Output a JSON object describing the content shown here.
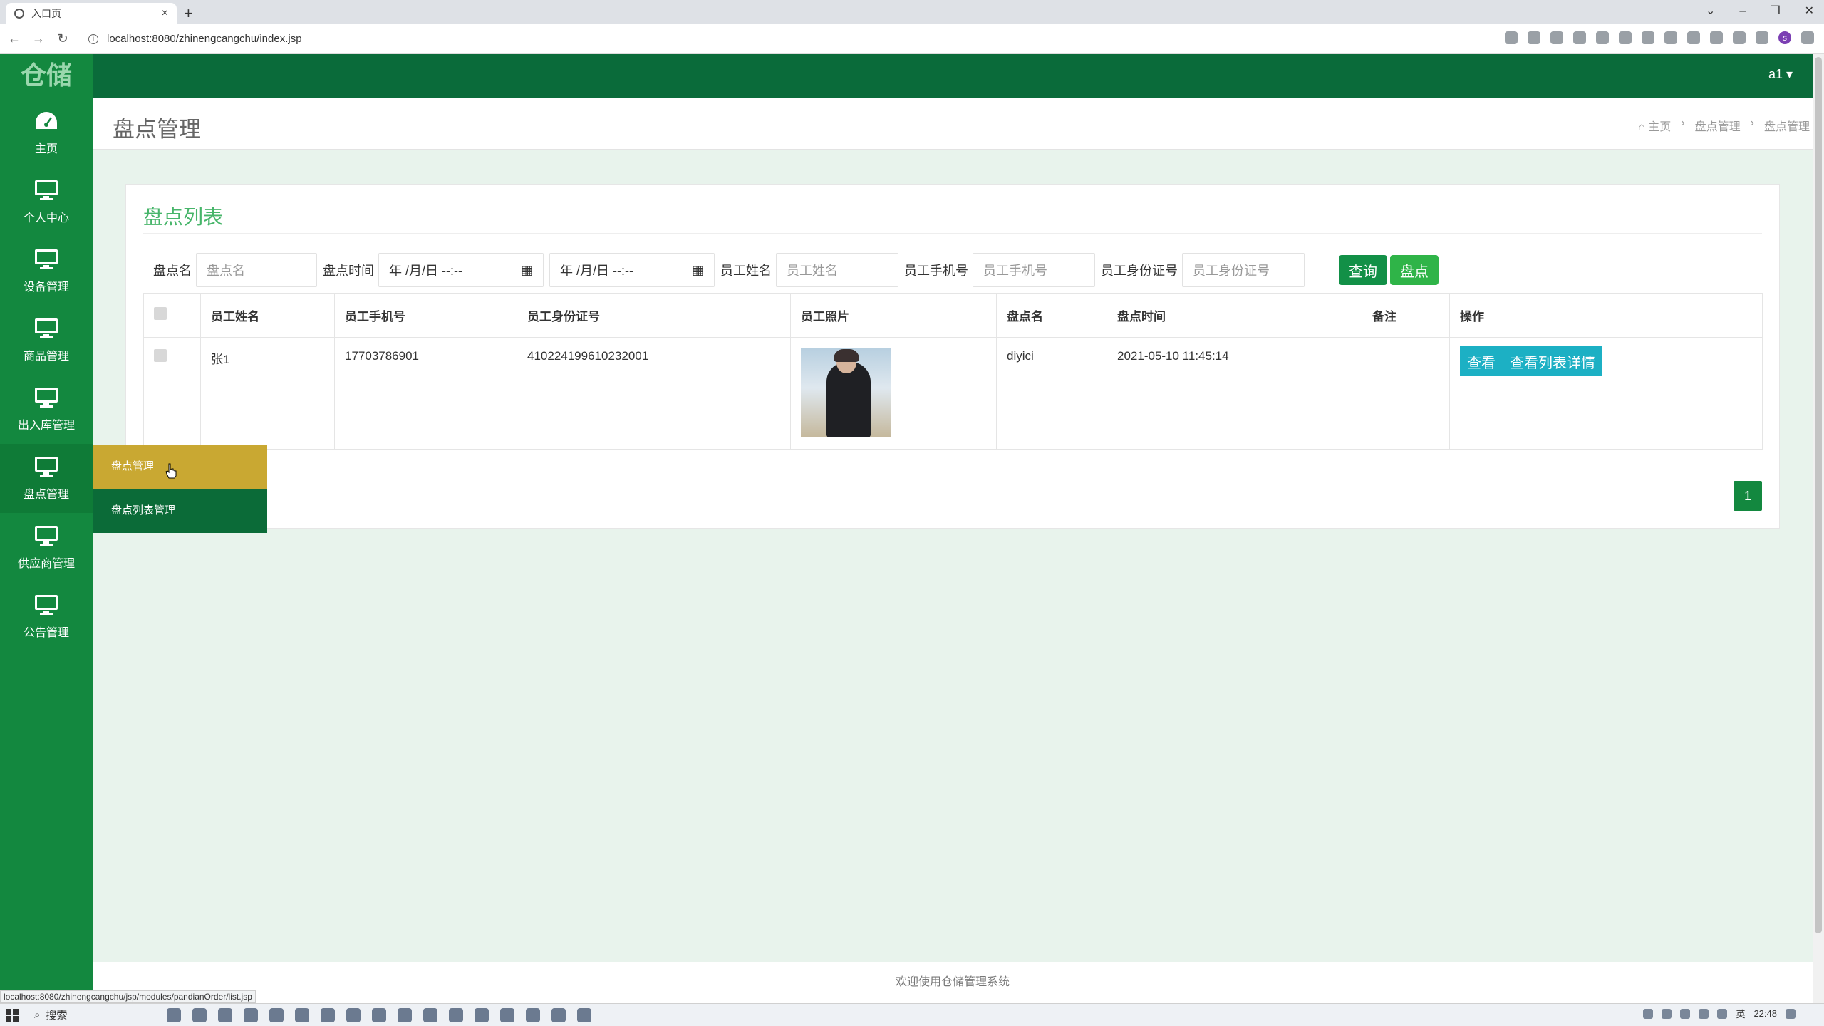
{
  "browser": {
    "tab_title": "入口页",
    "tab_close": "×",
    "new_tab": "+",
    "url": "localhost:8080/zhinengcangchu/index.jsp",
    "nav": {
      "back": "←",
      "forward": "→",
      "reload": "↻"
    },
    "window_controls": {
      "chevron": "⌄",
      "minimize": "–",
      "restore": "❐",
      "close": "✕"
    },
    "profile": "s",
    "status_url": "localhost:8080/zhinengcangchu/jsp/modules/pandianOrder/list.jsp"
  },
  "sidebar": {
    "logo": "仓储",
    "items": [
      {
        "label": "主页",
        "icon": "dashboard-icon"
      },
      {
        "label": "个人中心",
        "icon": "monitor-icon"
      },
      {
        "label": "设备管理",
        "icon": "monitor-icon"
      },
      {
        "label": "商品管理",
        "icon": "monitor-icon"
      },
      {
        "label": "出入库管理",
        "icon": "monitor-icon"
      },
      {
        "label": "盘点管理",
        "icon": "monitor-icon"
      },
      {
        "label": "供应商管理",
        "icon": "monitor-icon"
      },
      {
        "label": "公告管理",
        "icon": "monitor-icon"
      }
    ]
  },
  "submenu": {
    "items": [
      "盘点管理",
      "盘点列表管理"
    ]
  },
  "topbar": {
    "user": "a1 ▾"
  },
  "header": {
    "title": "盘点管理",
    "breadcrumb": [
      "⌂ 主页",
      "›",
      "盘点管理",
      "›",
      "盘点管理"
    ]
  },
  "panel": {
    "title": "盘点列表",
    "filters": {
      "name_label": "盘点名",
      "name_placeholder": "盘点名",
      "time_label": "盘点时间",
      "time_start": "年 /月/日 --:--",
      "time_end": "年 /月/日 --:--",
      "emp_name_label": "员工姓名",
      "emp_name_placeholder": "员工姓名",
      "phone_label": "员工手机号",
      "phone_placeholder": "员工手机号",
      "idcard_label": "员工身份证号",
      "idcard_placeholder": "员工身份证号",
      "query_button": "查询",
      "check_button": "盘点"
    },
    "table": {
      "headers": [
        "员工姓名",
        "员工手机号",
        "员工身份证号",
        "员工照片",
        "盘点名",
        "盘点时间",
        "备注",
        "操作"
      ],
      "rows": [
        {
          "emp_name": "张1",
          "phone": "17703786901",
          "idcard": "410224199610232001",
          "photo": "employee-photo",
          "name": "diyici",
          "time": "2021-05-10 11:45:14",
          "note": "",
          "view_button": "查看",
          "detail_button": "查看列表详情"
        }
      ]
    },
    "pagination": {
      "current": "1"
    }
  },
  "footer": {
    "text": "欢迎使用仓储管理系统"
  },
  "taskbar": {
    "search": "搜索",
    "time": "22:48",
    "lang": "英"
  },
  "colors": {
    "sidebar": "#13883f",
    "topbar": "#0a6b3a",
    "submenu_active": "#c9a832",
    "title_green": "#47b56a",
    "op_button": "#1cb0c4"
  }
}
